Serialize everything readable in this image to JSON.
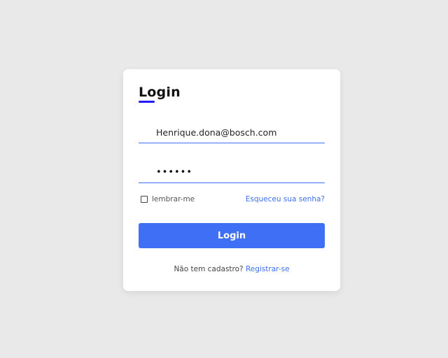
{
  "login": {
    "title": "Login",
    "email_value": "Henrique.dona@bosch.com",
    "password_value": "••••••",
    "remember_label": "lembrar-me",
    "forgot_label": "Esqueceu sua senha?",
    "submit_label": "Login",
    "signup_prompt": "Não tem cadastro?",
    "signup_link": "Registrar-se"
  },
  "colors": {
    "background": "#e9e9e9",
    "card": "#ffffff",
    "accent": "#3f6ff4",
    "title_underline": "#1f1aff"
  }
}
